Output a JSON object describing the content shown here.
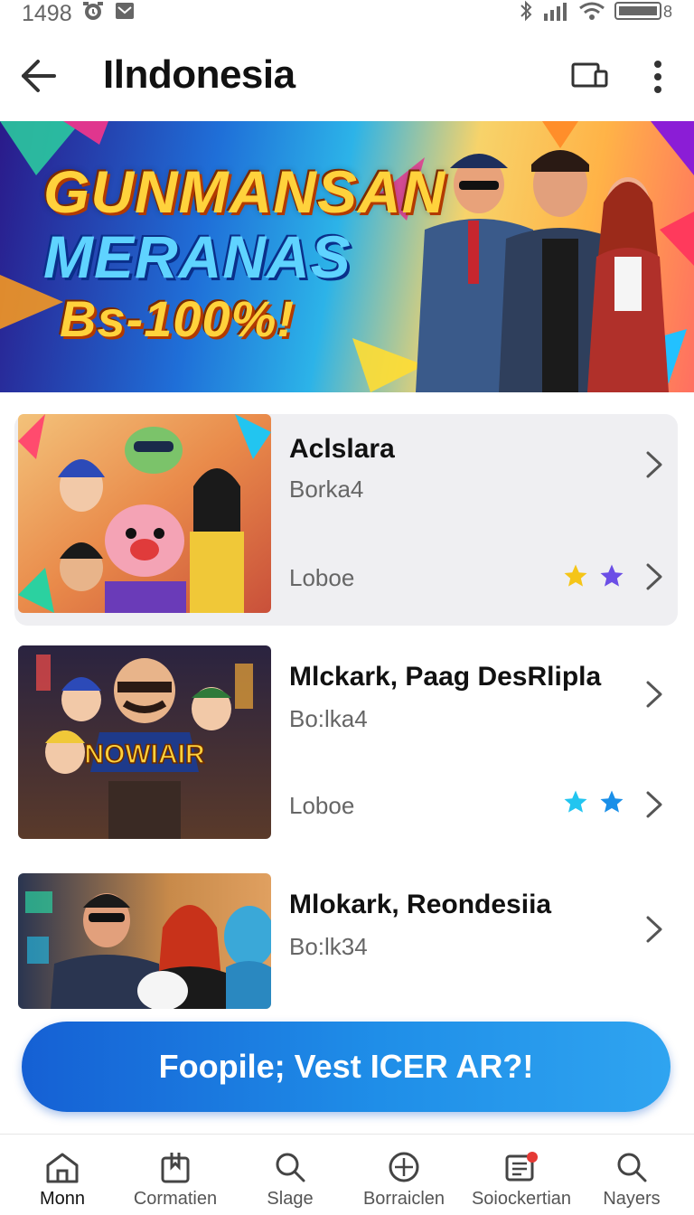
{
  "status_bar": {
    "time": "1498"
  },
  "app_bar": {
    "title": "Ilndonesia"
  },
  "banner": {
    "line1": "GUNMANSAN",
    "line2": "MERANAS",
    "line3": "Bs-100%!"
  },
  "items": [
    {
      "title": "Aclslara",
      "subtitle": "Borka4",
      "footer": "Loboe",
      "star_colors": [
        "#f5c518",
        "#6b4ee6"
      ]
    },
    {
      "title": "Mlckark, Paag DesRlipla",
      "subtitle": "Bo:lka4",
      "footer": "Loboe",
      "star_colors": [
        "#22c5f0",
        "#1a8fe8"
      ]
    },
    {
      "title": "Mlokark, Reondesiia",
      "subtitle": "Bo:lk34"
    }
  ],
  "cta": {
    "label": "Foopile; Vest ICER AR?!"
  },
  "bottom_nav": [
    {
      "label": "Monn",
      "icon": "home-icon"
    },
    {
      "label": "Cormatien",
      "icon": "bookmark-icon"
    },
    {
      "label": "Slage",
      "icon": "search-icon"
    },
    {
      "label": "Borraiclen",
      "icon": "compass-icon"
    },
    {
      "label": "Soiockertian",
      "icon": "notifications-icon"
    },
    {
      "label": "Nayers",
      "icon": "search-icon"
    }
  ],
  "colors": {
    "accent": "#1f8ee8",
    "notification_dot": "#e53935"
  }
}
